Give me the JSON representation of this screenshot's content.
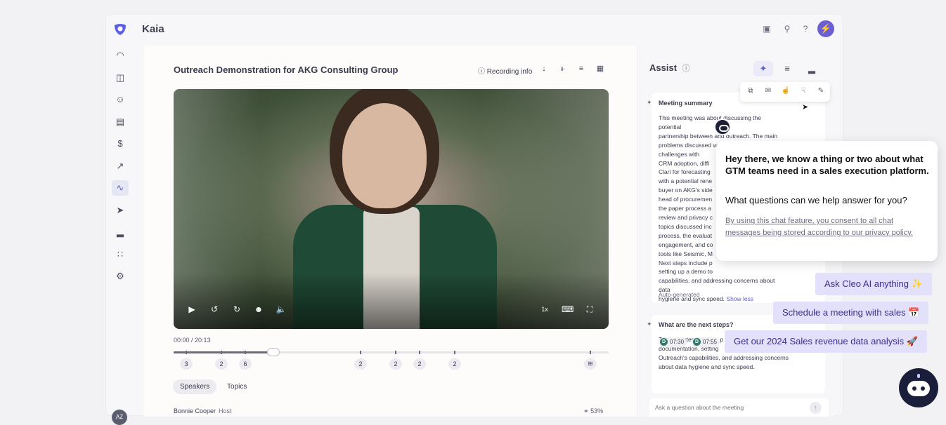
{
  "app": {
    "name": "Kaia",
    "accent": "#6b5fd3"
  },
  "topbar": {
    "icons": [
      "notes-icon",
      "search-icon",
      "help-icon",
      "bolt-icon"
    ],
    "help_glyph": "?"
  },
  "rail": {
    "items": [
      "activity-icon",
      "layout-icon",
      "users-icon",
      "briefcase-icon",
      "dollar-icon",
      "trend-icon",
      "conversation-icon",
      "send-icon",
      "bar-chart-icon",
      "apps-icon",
      "settings-icon"
    ],
    "avatar_initials": "AZ"
  },
  "meeting": {
    "title": "Outreach Demonstration for AKG Consulting Group",
    "recording_info_label": "Recording info",
    "time_current": "00:00",
    "time_total": "20:13",
    "progress_fraction": 0.0,
    "speed": "1x",
    "bubbles": [
      "3",
      "2",
      "6",
      "2",
      "2",
      "2",
      "2"
    ],
    "tabs": [
      "Speakers",
      "Topics"
    ],
    "active_tab": "Speakers",
    "speaker": {
      "name": "Bonnie Cooper",
      "role": "Host",
      "talk_pct": "53%"
    }
  },
  "assist": {
    "title": "Assist",
    "summary_title": "Meeting summary",
    "summary_lines": [
      "This meeting was about discussing the potential",
      "partnership between   and outreach. The main",
      "problems discussed were the current challenges with",
      "CRM adoption, diffi",
      "Clari for forecasting",
      "with a potential rene",
      "buyer on AKG's side",
      "head of procuremen",
      "the paper process a",
      "review and privacy c",
      "topics discussed inc",
      "process, the evaluat",
      "engagement, and co",
      "tools like Seismic, M",
      "Next steps include p",
      "setting up a demo to",
      "capabilities, and addressing concerns about data",
      "hygiene and sync speed."
    ],
    "show_less": "Show less",
    "auto_generated": "Auto-generated",
    "next_steps_title": "What are the next steps?",
    "next_steps_lines": [
      "The next steps include p",
      "documentation, setting",
      "Outreach's capabilities, and addressing concerns",
      "about data hygiene and sync speed."
    ],
    "timestamps": [
      {
        "initial": "D",
        "time": "07:30"
      },
      {
        "initial": "D",
        "time": "07:55"
      }
    ],
    "ask_placeholder": "Ask a question about the meeting"
  },
  "chat": {
    "headline": "Hey there, we know a thing or two about what GTM teams need in a sales execution platform.",
    "question": "What questions can we help answer for you?",
    "consent": "By using this chat feature, you consent to all chat messages being stored according to our privacy policy.",
    "suggestions": [
      "Ask Cleo AI anything ✨",
      "Schedule a meeting with sales 📅",
      "Get our 2024 Sales revenue data analysis 🚀"
    ]
  }
}
